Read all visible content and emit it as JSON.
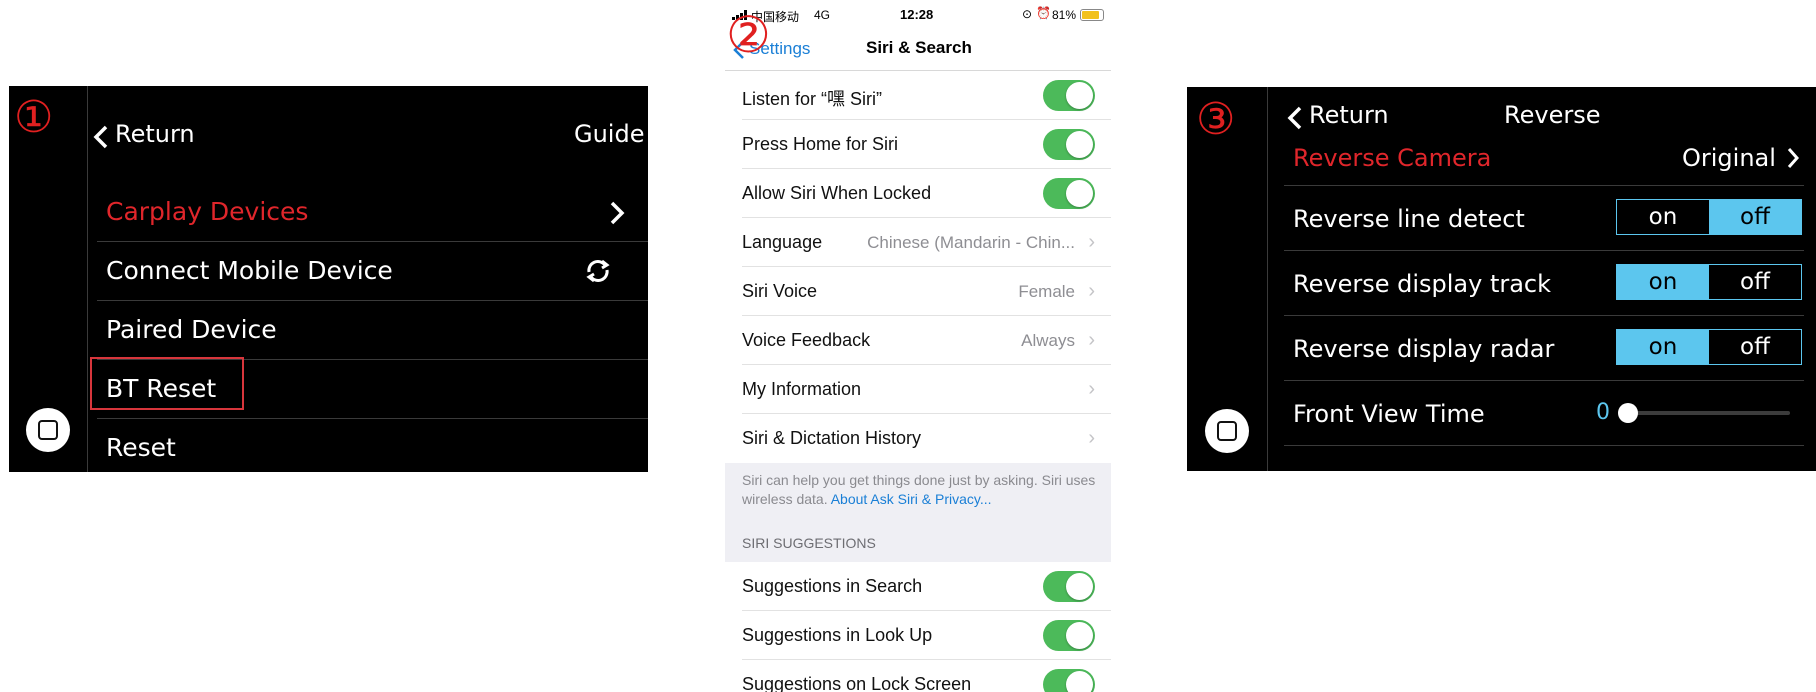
{
  "panel1": {
    "number": "①",
    "back_label": "Return",
    "guide_label": "Guide",
    "items": [
      {
        "label": "Carplay Devices"
      },
      {
        "label": "Connect Mobile Device"
      },
      {
        "label": "Paired Device"
      },
      {
        "label": "BT Reset"
      },
      {
        "label": "Reset"
      }
    ],
    "colors": {
      "active": "#e0262b",
      "highlight_box": "#d8363c"
    }
  },
  "panel2": {
    "number": "②",
    "status": {
      "carrier": "中国移动",
      "network": "4G",
      "time": "12:28",
      "battery": "81%"
    },
    "nav": {
      "back": "Settings",
      "title": "Siri & Search"
    },
    "rows": [
      {
        "label": "Listen for “嘿 Siri”",
        "toggle": true
      },
      {
        "label": "Press Home for Siri",
        "toggle": true
      },
      {
        "label": "Allow Siri When Locked",
        "toggle": true
      },
      {
        "label": "Language",
        "value": "Chinese (Mandarin - Chin..."
      },
      {
        "label": "Siri Voice",
        "value": "Female"
      },
      {
        "label": "Voice Feedback",
        "value": "Always"
      },
      {
        "label": "My Information",
        "value": ""
      },
      {
        "label": "Siri & Dictation History",
        "value": ""
      }
    ],
    "footer": {
      "text": "Siri can help you get things done just by asking. Siri uses wireless data.",
      "link": "About Ask Siri & Privacy..."
    },
    "suggestions_header": "SIRI SUGGESTIONS",
    "suggestions": [
      {
        "label": "Suggestions in Search",
        "toggle": true
      },
      {
        "label": "Suggestions in Look Up",
        "toggle": true
      },
      {
        "label": "Suggestions on Lock Screen",
        "toggle": true
      }
    ],
    "colors": {
      "toggle_on": "#4cba5a",
      "link": "#1a7fd6"
    }
  },
  "panel3": {
    "number": "③",
    "back_label": "Return",
    "title": "Reverse",
    "camera_label": "Reverse Camera",
    "camera_value": "Original",
    "rows": [
      {
        "label": "Reverse line detect",
        "on": "on",
        "off": "off",
        "selected": "off"
      },
      {
        "label": "Reverse display track",
        "on": "on",
        "off": "off",
        "selected": "on"
      },
      {
        "label": "Reverse display radar",
        "on": "on",
        "off": "off",
        "selected": "on"
      }
    ],
    "front_view_label": "Front View Time",
    "front_view_value": "0",
    "colors": {
      "accent": "#5cc6ee",
      "active": "#e0262b"
    }
  }
}
